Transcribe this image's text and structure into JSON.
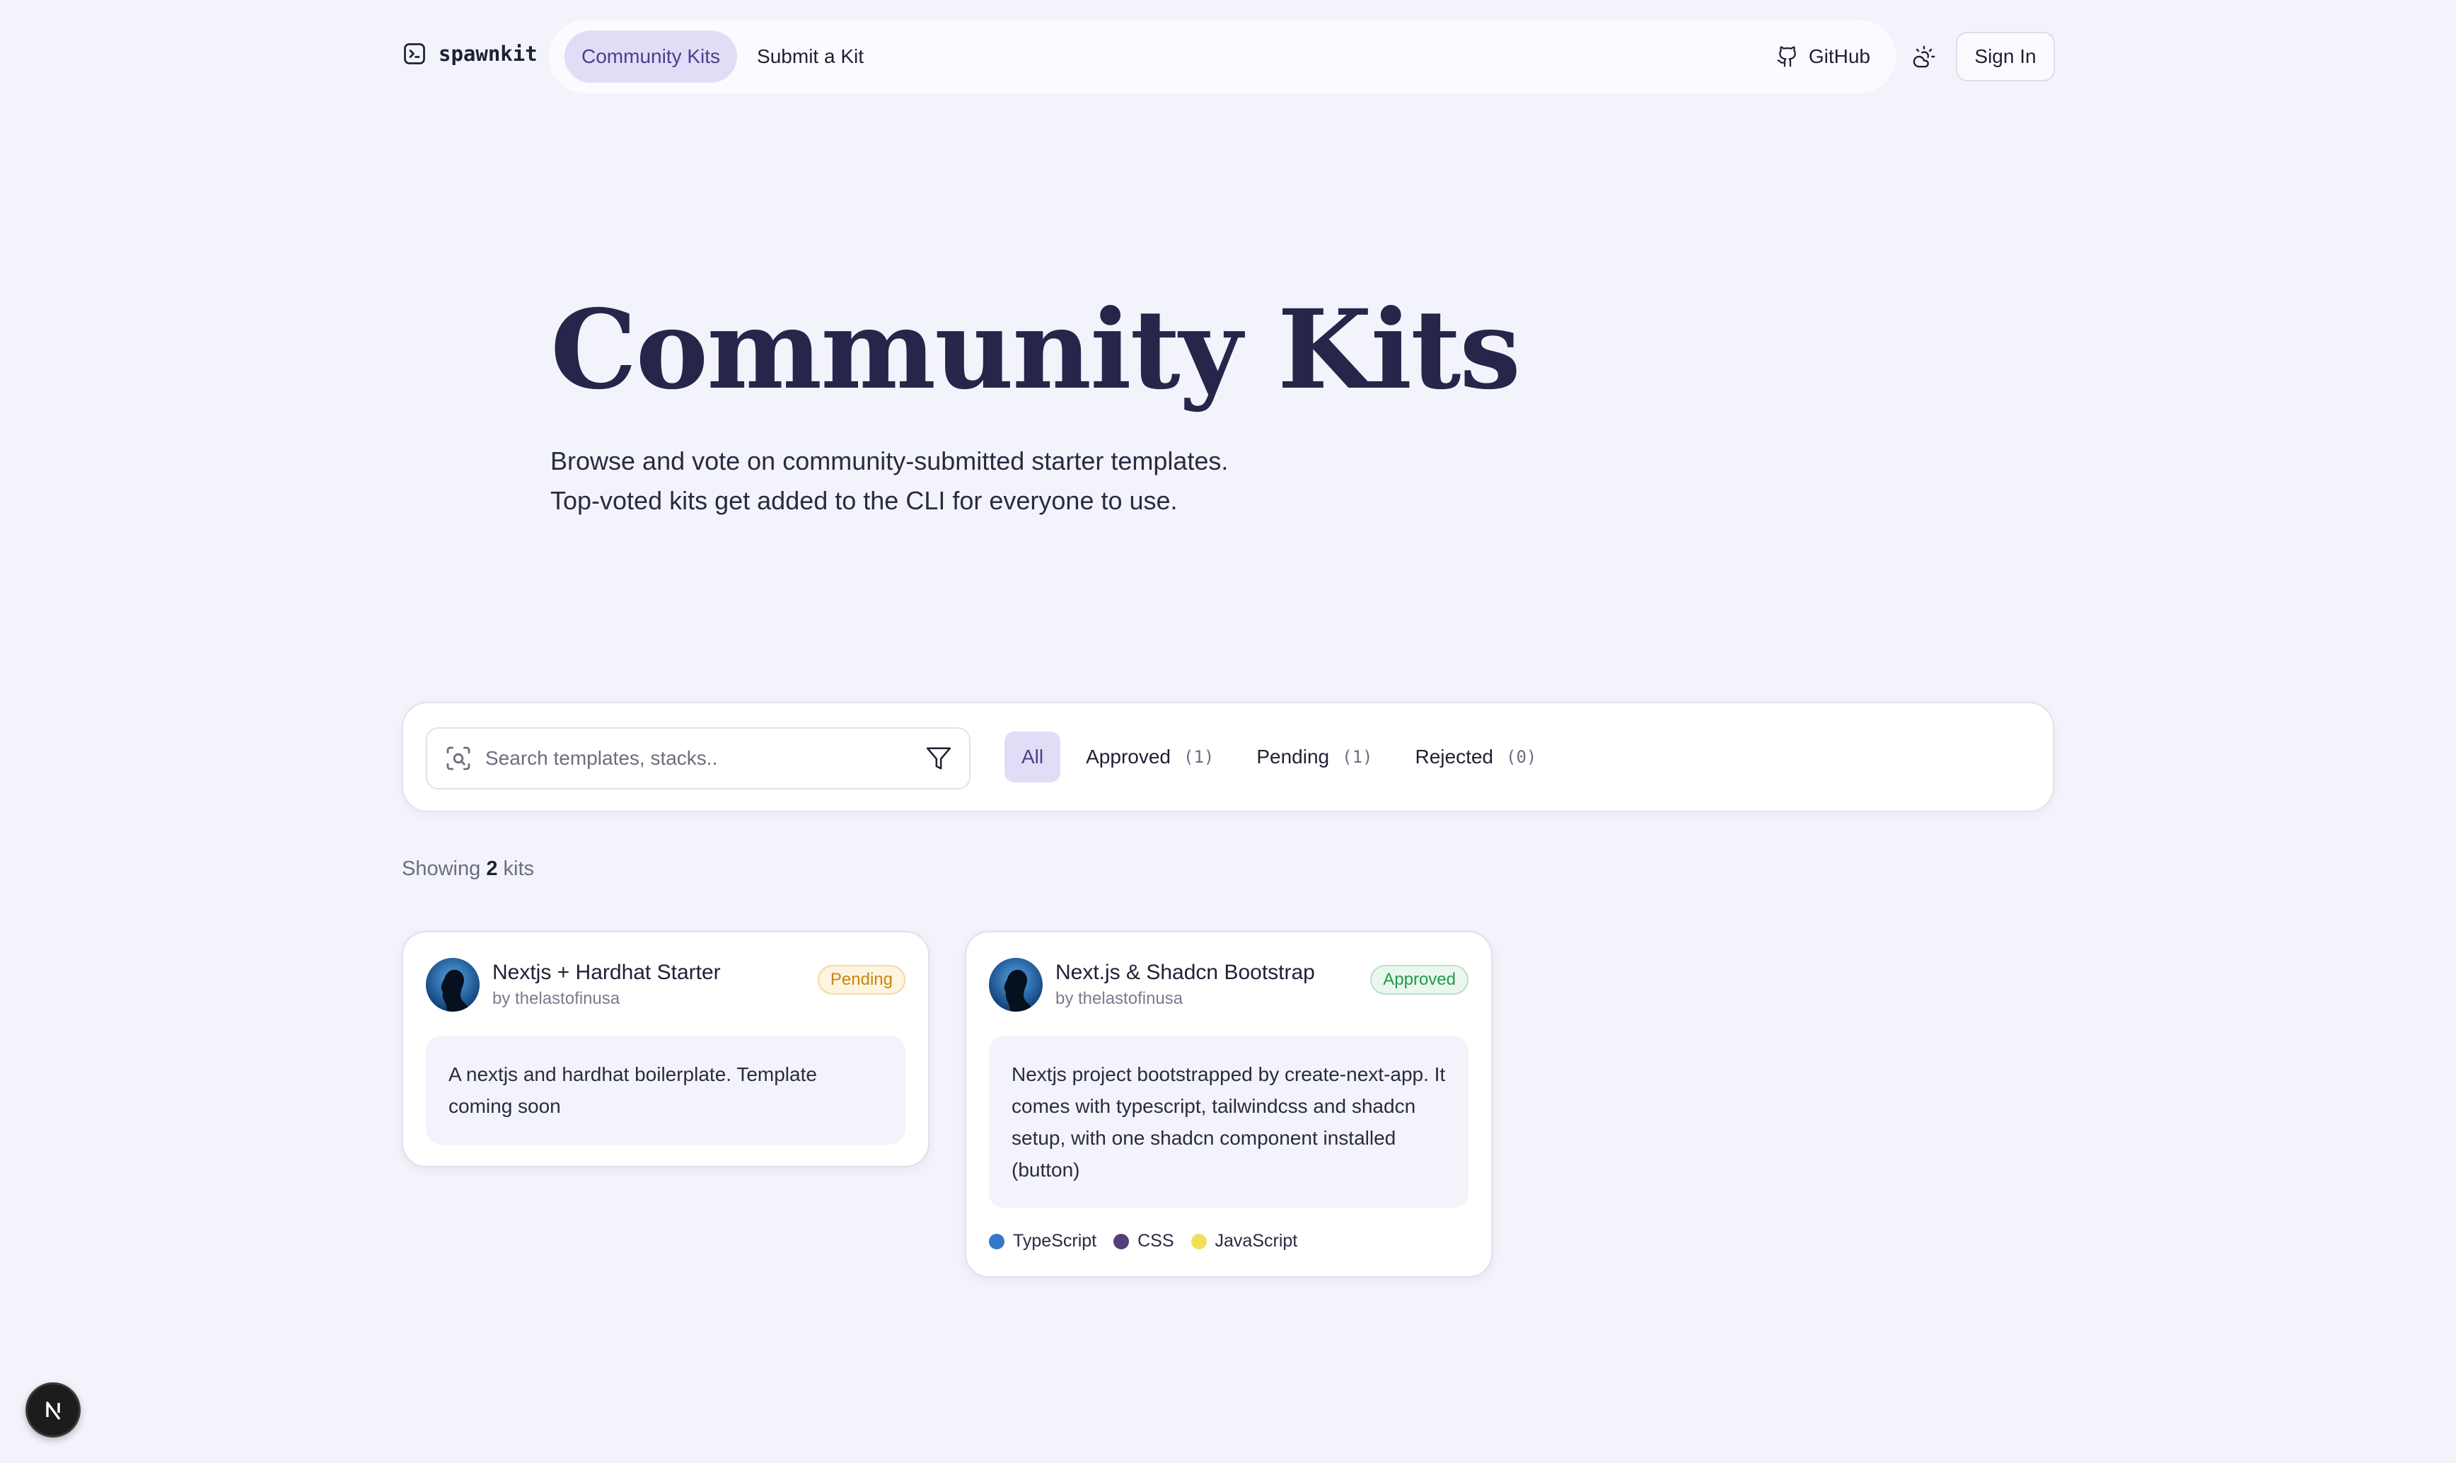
{
  "brand": {
    "name": "spawnkit"
  },
  "nav": {
    "tabs": [
      {
        "label": "Community Kits",
        "active": true
      },
      {
        "label": "Submit a Kit",
        "active": false
      }
    ],
    "github_label": "GitHub",
    "signin_label": "Sign In",
    "theme_icon": "cloud-sun-icon"
  },
  "hero": {
    "title": "Community Kits",
    "desc_line1": "Browse and vote on community-submitted starter templates.",
    "desc_line2": "Top-voted kits get added to the CLI for everyone to use."
  },
  "filters": {
    "search_placeholder": "Search templates, stacks..",
    "tabs": [
      {
        "label": "All",
        "count": "",
        "active": true
      },
      {
        "label": "Approved",
        "count": "(1)",
        "active": false
      },
      {
        "label": "Pending",
        "count": "(1)",
        "active": false
      },
      {
        "label": "Rejected",
        "count": "(0)",
        "active": false
      }
    ]
  },
  "results": {
    "prefix": "Showing",
    "count": "2",
    "suffix": "kits"
  },
  "kits": [
    {
      "title": "Nextjs + Hardhat Starter",
      "author": "by thelastofinusa",
      "status": "Pending",
      "description": "A nextjs and hardhat boilerplate. Template coming soon",
      "languages": []
    },
    {
      "title": "Next.js & Shadcn Bootstrap",
      "author": "by thelastofinusa",
      "status": "Approved",
      "description": "Nextjs project bootstrapped by create-next-app. It comes with typescript, tailwindcss and shadcn setup, with one shadcn component installed (button)",
      "languages": [
        {
          "name": "TypeScript",
          "color": "#3178c6"
        },
        {
          "name": "CSS",
          "color": "#563d7c"
        },
        {
          "name": "JavaScript",
          "color": "#f1e05a"
        }
      ]
    }
  ],
  "colors": {
    "background": "#f3f3fb",
    "accent": "#e2ddf7",
    "pending": "#c8860b",
    "approved": "#1f9a47"
  }
}
